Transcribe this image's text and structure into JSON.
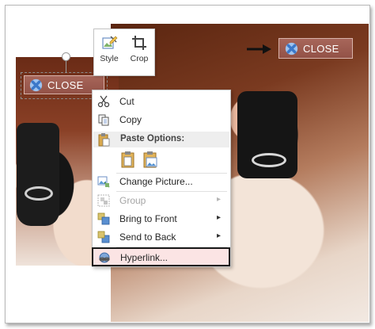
{
  "close_buttons": {
    "left_label": "CLOSE",
    "right_label": "CLOSE"
  },
  "mini_toolbar": {
    "style_label": "Style",
    "crop_label": "Crop"
  },
  "context_menu": {
    "cut": "Cut",
    "copy": "Copy",
    "paste_options": "Paste Options:",
    "change_picture": "Change Picture...",
    "group": "Group",
    "bring_to_front": "Bring to Front",
    "send_to_back": "Send to Back",
    "hyperlink": "Hyperlink..."
  },
  "colors": {
    "close_button": "#9b5a4e",
    "hyperlink_highlight": "#fbe4e4",
    "x_icon": "#5b8fd6"
  }
}
